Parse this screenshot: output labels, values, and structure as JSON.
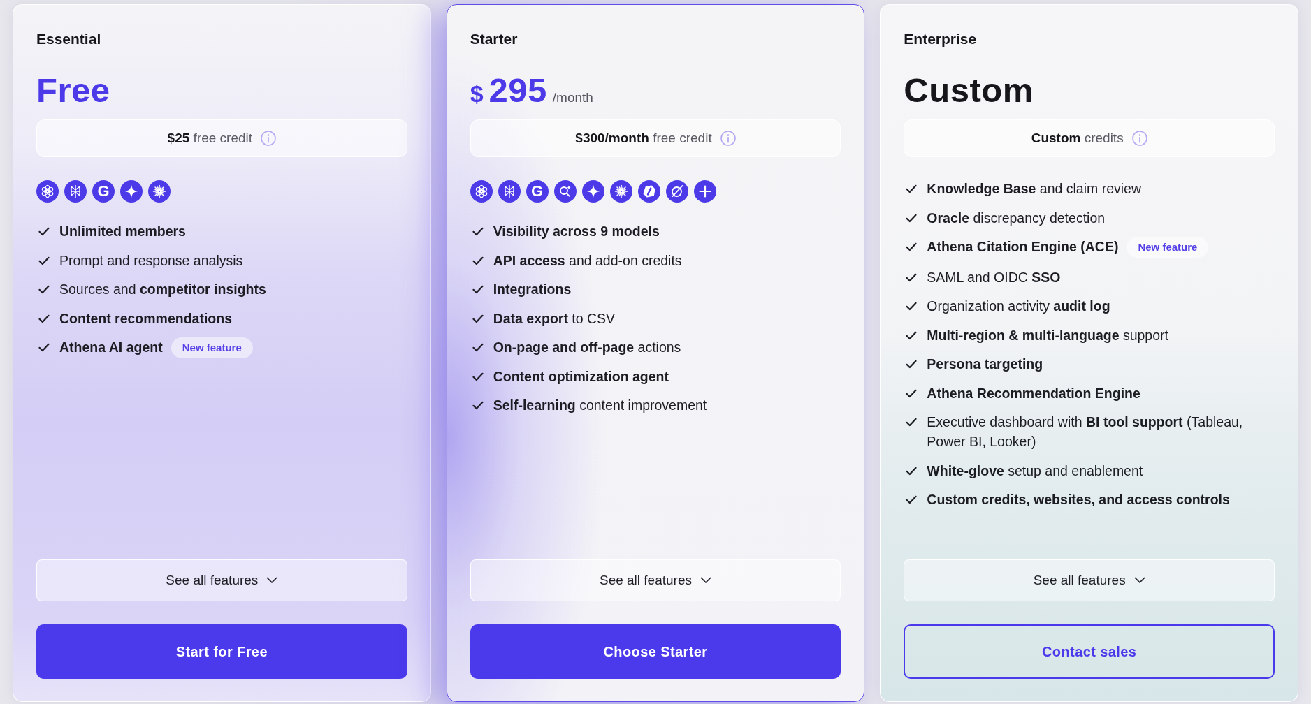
{
  "plans": [
    {
      "name": "Essential",
      "featured": false,
      "price": {
        "accent": true,
        "amount": "Free"
      },
      "credit": "**$25** free credit",
      "model_icons": [
        {
          "kind": "flower"
        },
        {
          "kind": "book"
        },
        {
          "kind": "letter",
          "text": "G"
        },
        {
          "kind": "sparkle"
        },
        {
          "kind": "burst"
        }
      ],
      "features": [
        {
          "text": "Unlimited members",
          "bold": true,
          "link": false
        },
        {
          "text": "Prompt and response analysis",
          "bold": false,
          "link": false
        },
        {
          "text": "Sources and **competitor insights**",
          "bold": false,
          "link": false
        },
        {
          "text": "Content recommendations",
          "bold": true,
          "link": false
        },
        {
          "text": "Athena AI agent",
          "bold": true,
          "link": false,
          "badge": "New feature"
        }
      ],
      "see_all": "See all features",
      "cta": {
        "label": "Start for Free",
        "kind": "filled"
      }
    },
    {
      "name": "Starter",
      "featured": true,
      "price": {
        "accent": true,
        "currency": "$",
        "amount": "295",
        "period": "/month"
      },
      "credit": "**$300/month** free credit",
      "model_icons": [
        {
          "kind": "flower"
        },
        {
          "kind": "book"
        },
        {
          "kind": "letter",
          "text": "G"
        },
        {
          "kind": "search-sparkle"
        },
        {
          "kind": "sparkle"
        },
        {
          "kind": "burst"
        },
        {
          "kind": "hexagon"
        },
        {
          "kind": "slashed-circle"
        },
        {
          "kind": "plus"
        }
      ],
      "features": [
        {
          "text": "Visibility across 9 models",
          "bold": true,
          "link": false
        },
        {
          "text": "**API access** and add-on credits",
          "bold": false,
          "link": false
        },
        {
          "text": "Integrations",
          "bold": true,
          "link": false
        },
        {
          "text": "**Data export** to CSV",
          "bold": false,
          "link": false
        },
        {
          "text": "**On-page and off-page** actions",
          "bold": false,
          "link": false
        },
        {
          "text": "Content optimization agent",
          "bold": true,
          "link": false
        },
        {
          "text": "**Self-learning** content improvement",
          "bold": false,
          "link": false
        }
      ],
      "see_all": "See all features",
      "cta": {
        "label": "Choose Starter",
        "kind": "filled"
      }
    },
    {
      "name": "Enterprise",
      "featured": false,
      "price": {
        "accent": false,
        "amount": "Custom"
      },
      "credit": "**Custom** credits",
      "features": [
        {
          "text": "**Knowledge Base** and claim review",
          "bold": false,
          "link": false
        },
        {
          "text": "**Oracle** discrepancy detection",
          "bold": false,
          "link": false
        },
        {
          "text": "Athena Citation Engine (ACE)",
          "bold": true,
          "link": true,
          "badge": "New feature"
        },
        {
          "text": "SAML and OIDC **SSO**",
          "bold": false,
          "link": false
        },
        {
          "text": "Organization activity **audit log**",
          "bold": false,
          "link": false
        },
        {
          "text": "**Multi-region & multi-language** support",
          "bold": false,
          "link": false
        },
        {
          "text": "Persona targeting",
          "bold": true,
          "link": false
        },
        {
          "text": "Athena Recommendation Engine",
          "bold": true,
          "link": false
        },
        {
          "text": "Executive dashboard with **BI tool support** (Tableau, Power BI, Looker)",
          "bold": false,
          "link": false
        },
        {
          "text": "**White-glove** setup and enablement",
          "bold": false,
          "link": false
        },
        {
          "text": "Custom credits, websites, and access controls",
          "bold": true,
          "link": false
        }
      ],
      "see_all": "See all features",
      "cta": {
        "label": "Contact sales",
        "kind": "outline"
      }
    }
  ]
}
